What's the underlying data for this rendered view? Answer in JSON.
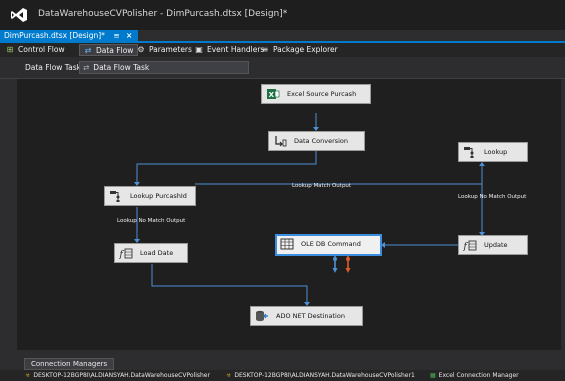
{
  "window": {
    "title": "DataWarehouseCVPolisher - DimPurcash.dtsx [Design]*"
  },
  "document_tab": {
    "label": "DimPurcash.dtsx [Design]*",
    "pin": "≡",
    "close": "×"
  },
  "designer_tabs": [
    {
      "label": "Control Flow",
      "icon": "control-flow-icon",
      "active": false
    },
    {
      "label": "Data Flow",
      "icon": "data-flow-icon",
      "active": true
    },
    {
      "label": "Parameters",
      "icon": "parameters-icon",
      "active": false
    },
    {
      "label": "Event Handlers",
      "icon": "event-handlers-icon",
      "active": false
    },
    {
      "label": "Package Explorer",
      "icon": "package-explorer-icon",
      "active": false
    }
  ],
  "task_bar": {
    "label": "Data Flow Task:",
    "selected": "Data Flow Task"
  },
  "components": {
    "excel_source": {
      "label": "Excel Source Purcash",
      "icon": "excel-source-icon"
    },
    "data_conversion": {
      "label": "Data Conversion",
      "icon": "data-conversion-icon"
    },
    "lookup_purcashid": {
      "label": "Lookup PurcashId",
      "icon": "lookup-icon"
    },
    "lookup": {
      "label": "Lookup",
      "icon": "lookup-icon"
    },
    "load_date": {
      "label": "Load Date",
      "icon": "derived-column-icon"
    },
    "ole_db_command": {
      "label": "OLE DB Command",
      "icon": "ole-db-command-icon"
    },
    "update": {
      "label": "Update",
      "icon": "derived-column-icon"
    },
    "ado_net_destination": {
      "label": "ADO NET Destination",
      "icon": "ado-net-destination-icon"
    }
  },
  "path_labels": {
    "lookup_match_output": "Lookup Match Output",
    "lookup_no_match_left": "Lookup No Match Output",
    "lookup_no_match_right": "Lookup No Match Output"
  },
  "connection_managers": {
    "tab_label": "Connection Managers",
    "items": [
      {
        "label": "DESKTOP-12BGP8I\\ALDIANSYAH.DataWarehouseCVPolisher",
        "icon": "db-connection-icon"
      },
      {
        "label": "DESKTOP-12BGP8I\\ALDIANSYAH.DataWarehouseCVPolisher1",
        "icon": "db-connection-icon"
      },
      {
        "label": "Excel Connection Manager",
        "icon": "excel-connection-icon"
      }
    ]
  },
  "colors": {
    "accent": "#007acc",
    "wire": "#4f8fd6",
    "error_wire": "#e05a2a",
    "canvas": "#1f1f1f"
  }
}
